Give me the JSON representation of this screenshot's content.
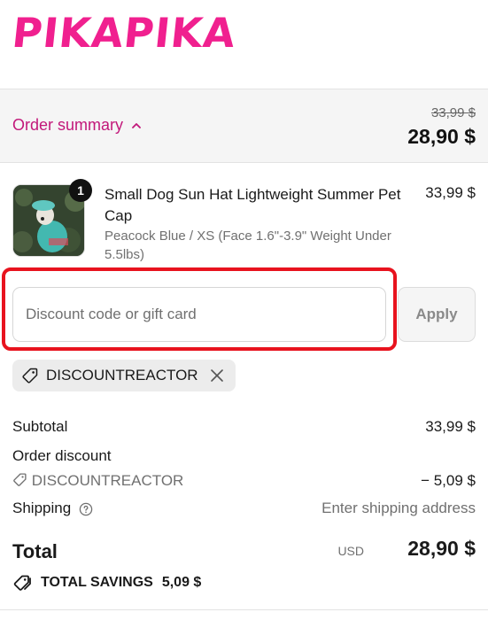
{
  "brand": {
    "name": "PIKAPIKA",
    "color": "#f0208f"
  },
  "summary": {
    "toggle_label": "Order summary",
    "original_total": "33,99 $",
    "total": "28,90 $"
  },
  "product": {
    "quantity": "1",
    "title": "Small Dog Sun Hat Lightweight Summer Pet Cap",
    "variant": "Peacock Blue / XS (Face 1.6\"-3.9\" Weight Under 5.5lbs)",
    "price": "33,99 $"
  },
  "discount": {
    "placeholder": "Discount code or gift card",
    "value": "",
    "apply_label": "Apply",
    "applied_code": "DISCOUNTREACTOR"
  },
  "totals": {
    "subtotal_label": "Subtotal",
    "subtotal_value": "33,99 $",
    "order_discount_label": "Order discount",
    "order_discount_code": "DISCOUNTREACTOR",
    "order_discount_value": "− 5,09 $",
    "shipping_label": "Shipping",
    "shipping_value": "Enter shipping address",
    "total_label": "Total",
    "currency": "USD",
    "total_value": "28,90 $",
    "savings_label": "TOTAL SAVINGS",
    "savings_value": "5,09 $"
  },
  "colors": {
    "accent": "#c2187a",
    "highlight": "#e8131e"
  }
}
